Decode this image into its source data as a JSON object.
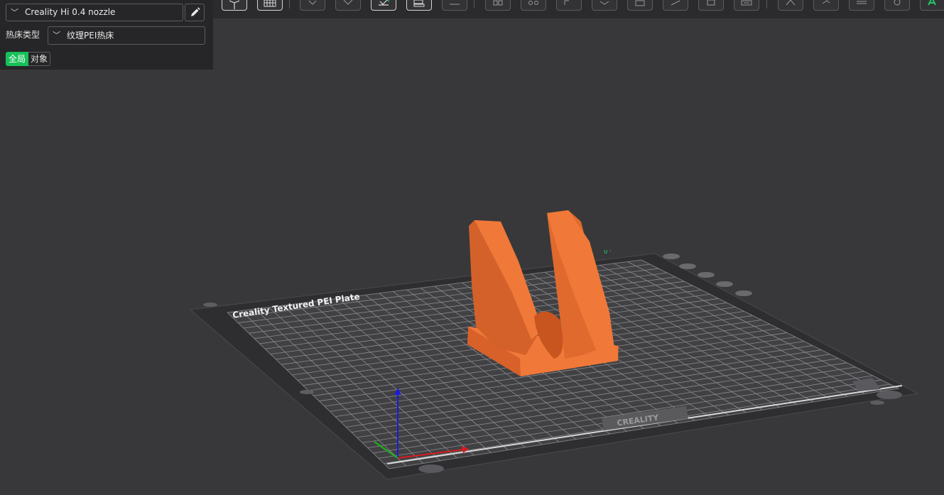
{
  "printer": {
    "selected": "Creality Hi 0.4 nozzle"
  },
  "bed": {
    "label": "热床类型",
    "selected": "纹理PEI热床"
  },
  "scope": {
    "global_label": "全局",
    "object_label": "对象"
  },
  "plate": {
    "title": "Creality Textured PEI Plate",
    "brand": "CREALITY"
  },
  "colors": {
    "accent": "#17c15a",
    "model": "#f07838",
    "background": "#38383a"
  },
  "toolbar": {
    "icons": [
      "view-cube-icon",
      "grid-icon",
      "add-icon",
      "orient-icon",
      "arrange-icon",
      "split-icon",
      "layers-icon",
      "move-icon",
      "rotate-icon",
      "scale-icon",
      "cut-icon",
      "support-icon",
      "seam-icon",
      "measure-icon",
      "assembly-icon",
      "text-icon",
      "paint-icon",
      "emboss-icon",
      "settings-icon",
      "a-icon"
    ]
  }
}
